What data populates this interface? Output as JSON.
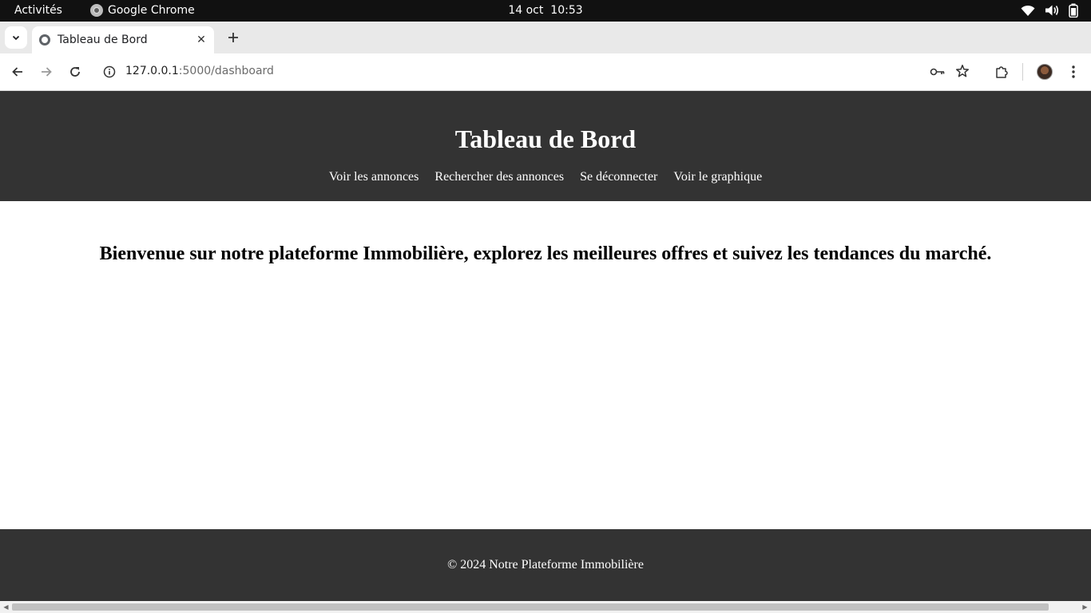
{
  "system_bar": {
    "activities": "Activités",
    "app_name": "Google Chrome",
    "date": "14 oct",
    "time": "10:53"
  },
  "browser": {
    "tab_title": "Tableau de Bord",
    "url_host": "127.0.0.1",
    "url_path": ":5000/dashboard"
  },
  "page": {
    "title": "Tableau de Bord",
    "nav": [
      "Voir les annonces",
      "Rechercher des annonces",
      "Se déconnecter",
      "Voir le graphique"
    ],
    "welcome": "Bienvenue sur notre plateforme Immobilière, explorez les meilleures offres et suivez les tendances du marché.",
    "footer": "© 2024 Notre Plateforme Immobilière"
  },
  "icons": {
    "wifi": "wifi-icon",
    "volume": "volume-icon",
    "battery": "battery-icon",
    "back": "arrow-left-icon",
    "forward": "arrow-right-icon",
    "reload": "reload-icon",
    "site_info": "info-icon",
    "password_key": "key-icon",
    "bookmark": "star-icon",
    "extensions": "puzzle-icon",
    "menu": "kebab-menu-icon"
  },
  "colors": {
    "header_bg": "#333333",
    "footer_bg": "#333333",
    "topbar_bg": "#111111",
    "tabstrip_bg": "#e9e9e9"
  }
}
